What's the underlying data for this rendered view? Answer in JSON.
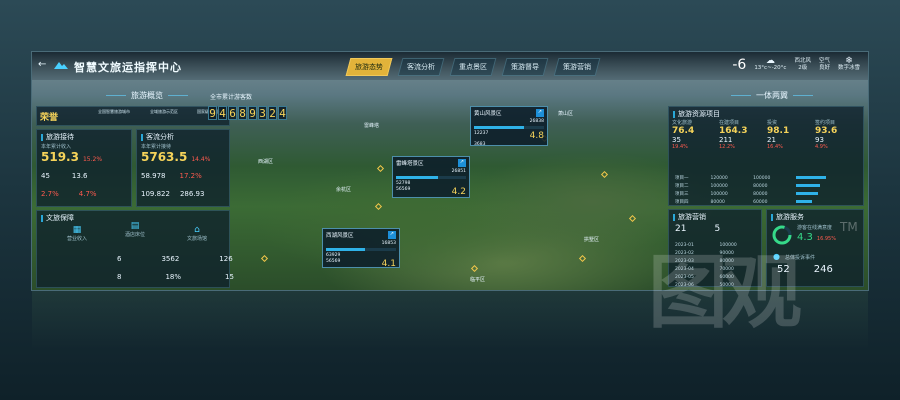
{
  "topbar": {
    "title": "智慧文旅运指挥中心",
    "tabs": [
      {
        "label": "旅游态势",
        "active": true
      },
      {
        "label": "客流分析",
        "active": false
      },
      {
        "label": "重点景区",
        "active": false
      },
      {
        "label": "策游督导",
        "active": false
      },
      {
        "label": "策游营销",
        "active": false
      }
    ],
    "temperature": "-6",
    "weather_range": "13°c~-20°c",
    "wind": "西北风",
    "wind_level": "2级",
    "air": "空气",
    "air_level": "良好",
    "app_label": "数字冰雪"
  },
  "left": {
    "header": "旅游概览",
    "honor": "荣誉",
    "honor_items": [
      "全国智慧旅游城市",
      "全域旅游示范区",
      "国家级度假区"
    ],
    "tourism_title": "旅游接待",
    "tourism_sub": "本年累计收入",
    "tourism_big": "519.3",
    "tourism_big_pct": "15.2%",
    "tourism_rows": [
      {
        "a": "45",
        "b": "13.6"
      },
      {
        "a": "2.7%",
        "b": "4.7%"
      }
    ],
    "flow_title": "客流分析",
    "flow_sub": "本年累计接待",
    "flow_big": "5763.5",
    "flow_big_pct": "14.4%",
    "flow_rows": [
      {
        "a": "58.978",
        "b": "17.2%"
      },
      {
        "a": "109.822",
        "b": "286.93"
      }
    ],
    "culture_title": "文旅保障",
    "culture_items": [
      "营业收入",
      "酒店床位",
      "文旅场馆"
    ],
    "culture_nums": [
      {
        "a": "6",
        "b": "3562",
        "c": "126"
      },
      {
        "a": "8",
        "b": "18%",
        "c": "15"
      }
    ]
  },
  "counter": {
    "label": "全市累计游客数",
    "digits": [
      "9",
      "4",
      "6",
      "8",
      "9",
      "3",
      "2",
      "4"
    ]
  },
  "popups": [
    {
      "name": "黄山风景区",
      "total": "26838",
      "r1": "12237",
      "r2": "3683",
      "big": "4.8",
      "fill": 0.72
    },
    {
      "name": "雷峰塔景区",
      "total": "26851",
      "r1": "52798",
      "r2": "56569",
      "big": "4.2",
      "fill": 0.6
    },
    {
      "name": "西湖风景区",
      "total": "16853",
      "r1": "63929",
      "r2": "56569",
      "big": "4.1",
      "fill": 0.55
    }
  ],
  "places": [
    "雷峰塔",
    "西湖区",
    "余杭区",
    "萧山区",
    "临平区",
    "拱墅区"
  ],
  "right": {
    "header": "一体两翼",
    "resource_title": "旅游资源项目",
    "resource_items": [
      {
        "label": "文化旅游",
        "big": "76.4",
        "sub": "35",
        "pct": "19.4%"
      },
      {
        "label": "在建项目",
        "big": "164.3",
        "sub": "211",
        "pct": "12.2%"
      },
      {
        "label": "投资",
        "big": "98.1",
        "sub": "21",
        "pct": "16.4%"
      },
      {
        "label": "签约项目",
        "big": "93.6",
        "sub": "93",
        "pct": "4.9%"
      }
    ],
    "table_rows": [
      {
        "name": "项目一",
        "v1": "120000",
        "v2": "100000"
      },
      {
        "name": "项目二",
        "v1": "100000",
        "v2": "80000"
      },
      {
        "name": "项目三",
        "v1": "100000",
        "v2": "80000"
      },
      {
        "name": "项目四",
        "v1": "80000",
        "v2": "60000"
      }
    ],
    "marketing_title": "旅游营销",
    "marketing_nums": {
      "a": "21",
      "b": "5"
    },
    "service_title": "旅游服务",
    "service_sub": "游客在线满意度",
    "service_big": "4.3",
    "service_pct": "16.95%",
    "complaint_label": "总体投诉事件",
    "complaint_big": "52",
    "complaint_sub": "246",
    "market_list": [
      {
        "date": "2023-01",
        "v": "100000"
      },
      {
        "date": "2023-02",
        "v": "90000"
      },
      {
        "date": "2023-03",
        "v": "80000"
      },
      {
        "date": "2023-04",
        "v": "70000"
      },
      {
        "date": "2023-05",
        "v": "60000"
      },
      {
        "date": "2023-06",
        "v": "50000"
      }
    ]
  },
  "watermark": {
    "text": "图观",
    "tm": "TM"
  }
}
